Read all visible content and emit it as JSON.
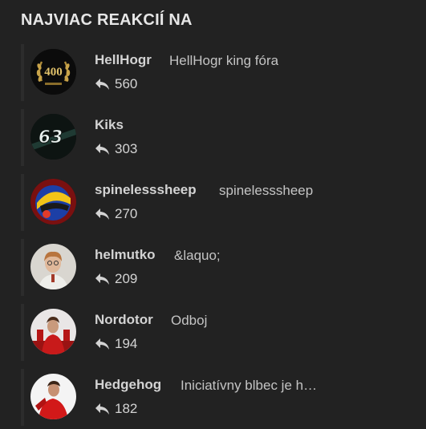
{
  "widget": {
    "title": "NAJVIAC REAKCIÍ NA"
  },
  "users": [
    {
      "name": "HellHogr",
      "signature": "HellHogr king fóra",
      "count": "560",
      "avatar": "gold-laurel-400-badge"
    },
    {
      "name": "Kiks",
      "signature": "",
      "count": "303",
      "avatar": "racing-number-63"
    },
    {
      "name": "spinelesssheep",
      "signature": "spinelesssheep",
      "count": "270",
      "avatar": "racing-helmet"
    },
    {
      "name": "helmutko",
      "signature": "&laquo;",
      "count": "209",
      "avatar": "person-portrait"
    },
    {
      "name": "Nordotor",
      "signature": "Odboj",
      "count": "194",
      "avatar": "red-team-driver"
    },
    {
      "name": "Hedgehog",
      "signature": "Iniciatívny blbec je h…",
      "count": "182",
      "avatar": "red-team-driver-white"
    }
  ],
  "icons": {
    "reply": "reply-arrow-icon"
  },
  "colors": {
    "background": "#222222",
    "text": "#d3d3d3",
    "title": "#e6e6e6",
    "item_border": "#2c2c2c"
  }
}
